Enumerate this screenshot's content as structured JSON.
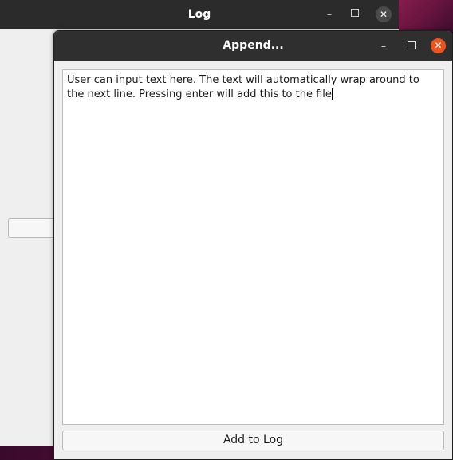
{
  "log_window": {
    "title": "Log",
    "controls": {
      "minimize_glyph": "–",
      "maximize_glyph": "",
      "close_glyph": "✕"
    }
  },
  "append_window": {
    "title": "Append...",
    "controls": {
      "minimize_glyph": "–",
      "maximize_glyph": "",
      "close_glyph": "✕"
    },
    "text_input": {
      "value": "User can input text here. The text will automatically wrap around to the next line. Pressing enter will add this to the file"
    },
    "add_button_label": "Add to Log"
  },
  "colors": {
    "titlebar": "#2f2f2f",
    "window_bg": "#efefef",
    "close_accent": "#e95420",
    "wallpaper": "#6a1540"
  },
  "icons": [
    "minimize-icon",
    "maximize-icon",
    "close-icon"
  ]
}
